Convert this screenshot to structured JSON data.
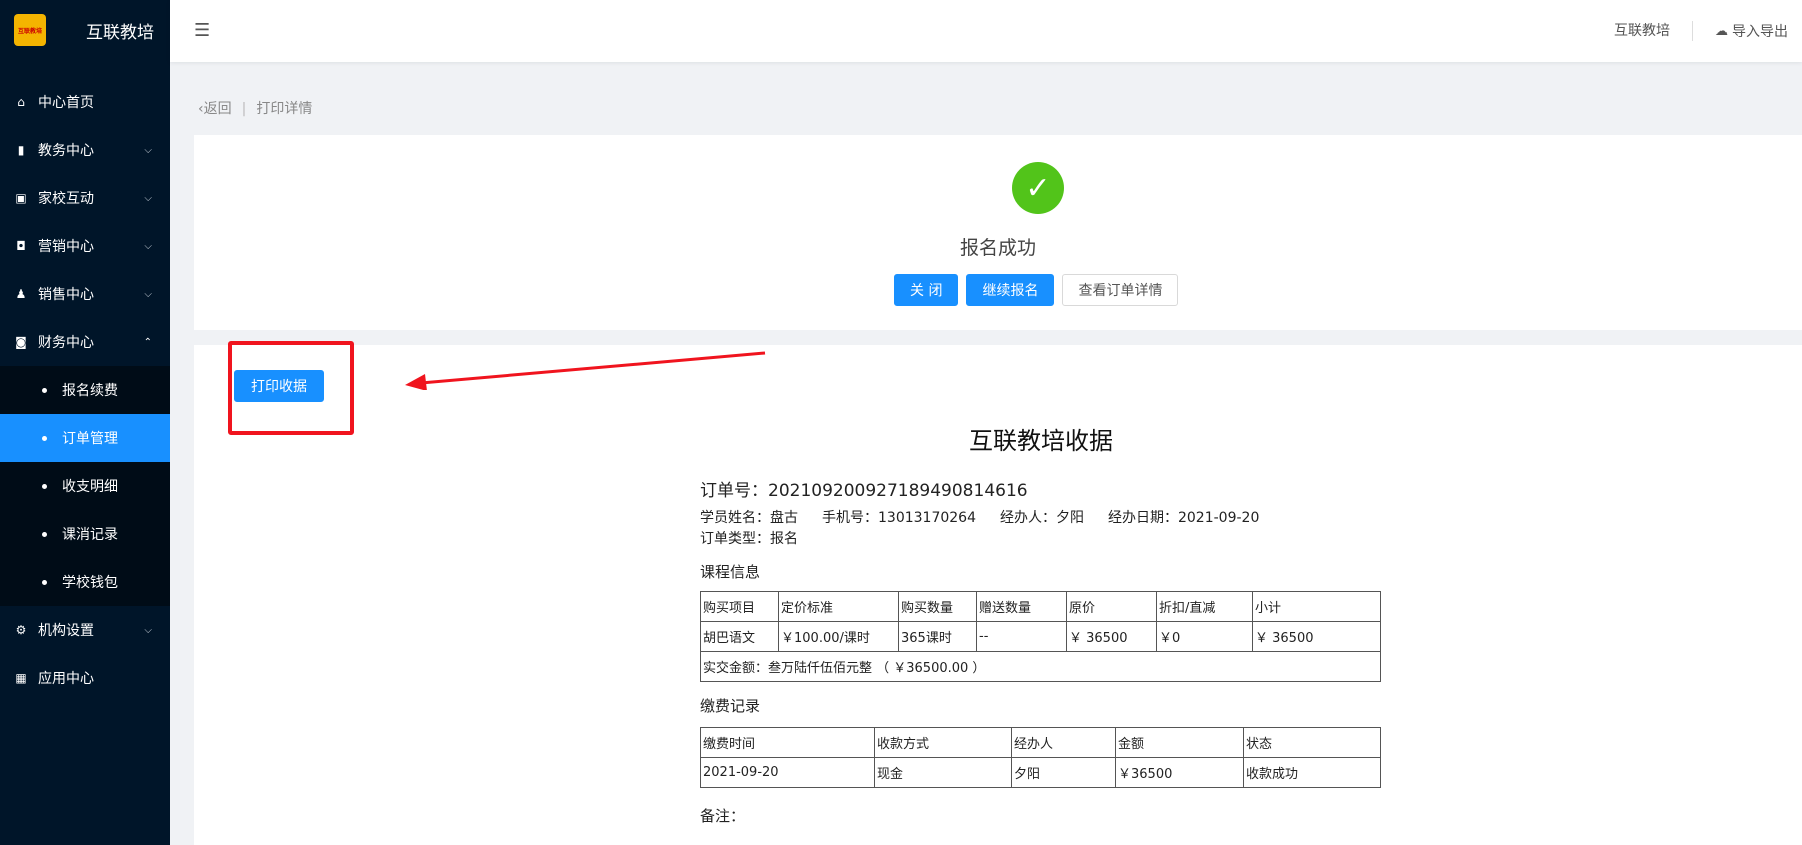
{
  "app": {
    "brand": "互联教培",
    "logo_text": "互联教培"
  },
  "sidebar": {
    "items": [
      {
        "label": "中心首页",
        "icon": "home-icon"
      },
      {
        "label": "教务中心",
        "icon": "book-icon"
      },
      {
        "label": "家校互动",
        "icon": "chat-icon"
      },
      {
        "label": "营销中心",
        "icon": "bag-icon"
      },
      {
        "label": "销售中心",
        "icon": "people-icon"
      },
      {
        "label": "财务中心",
        "icon": "wallet-icon"
      },
      {
        "label": "机构设置",
        "icon": "gear-icon"
      },
      {
        "label": "应用中心",
        "icon": "grid-icon"
      }
    ],
    "finance_sub": [
      "报名续费",
      "订单管理",
      "收支明细",
      "课消记录",
      "学校钱包"
    ],
    "active_sub": "订单管理"
  },
  "header": {
    "user": "互联教培",
    "import_export": "导入导出"
  },
  "breadcrumb": {
    "back": "返回",
    "current": "打印详情"
  },
  "success": {
    "title": "报名成功",
    "close_btn": "关 闭",
    "continue_btn": "继续报名",
    "view_btn": "查看订单详情"
  },
  "print_btn": "打印收据",
  "receipt": {
    "title": "互联教培收据",
    "order_no": "订单号：20210920092718949081461 6",
    "student": "学员姓名：盘古",
    "phone": "手机号：13013170264",
    "handler": "经办人：夕阳",
    "date": "经办日期：2021-09-20",
    "order_type": "订单类型：报名",
    "course_section": "课程信息",
    "course_headers": [
      "购买项目",
      "定价标准",
      "购买数量",
      "赠送数量",
      "原价",
      "折扣/直减",
      "小计"
    ],
    "course_row": [
      "胡巴语文",
      "￥100.00/课时",
      "365课时",
      "--",
      "￥ 36500",
      "￥0",
      "￥ 36500"
    ],
    "total": "实交金额：叁万陆仟伍佰元整 （ ￥36500.00 ）",
    "payment_section": "缴费记录",
    "payment_headers": [
      "缴费时间",
      "收款方式",
      "经办人",
      "金额",
      "状态"
    ],
    "payment_row": [
      "2021-09-20",
      "现金",
      "夕阳",
      "￥36500",
      "收款成功"
    ],
    "note": "备注："
  },
  "colors": {
    "sidebar_bg": "#001529",
    "primary": "#1890ff",
    "success": "#52c41a",
    "highlight": "#f0141e"
  }
}
